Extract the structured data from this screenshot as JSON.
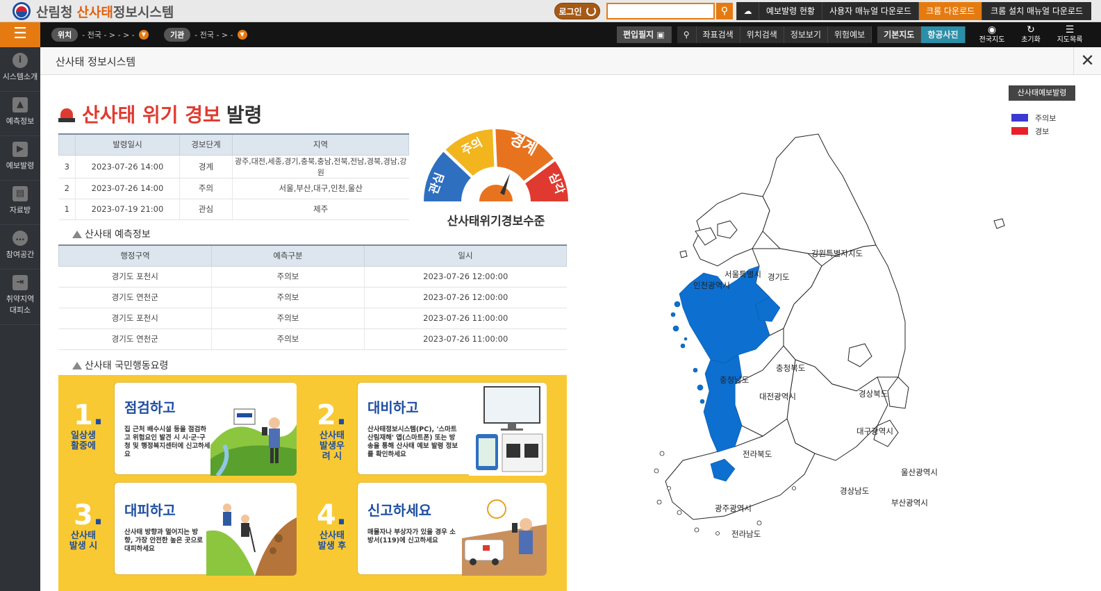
{
  "header": {
    "logo_main": "산림청",
    "logo_sub_accent": "산사태",
    "logo_sub_rest": "정보시스템",
    "login_label": "로그인",
    "search_placeholder": "",
    "links": [
      "예보발령 현황",
      "사용자 매뉴얼 다운로드",
      "크롬 다운로드",
      "크롬 설치 매뉴얼 다운로드"
    ]
  },
  "navbar": {
    "location_tag": "위치",
    "location_value": "- 전국 - > - > -",
    "agency_tag": "기관",
    "agency_value": "- 전국 - > -",
    "buttons": [
      "편입필지",
      "좌표검색",
      "위치검색",
      "정보보기",
      "위험예보",
      "기본지도",
      "항공사진"
    ],
    "icons": [
      {
        "label": "전국지도",
        "icon": "eye-icon"
      },
      {
        "label": "초기화",
        "icon": "refresh-icon"
      },
      {
        "label": "지도목록",
        "icon": "list-icon"
      }
    ]
  },
  "sidebar": {
    "items": [
      {
        "label": "시스템소개",
        "icon": "info-icon"
      },
      {
        "label": "예측정보",
        "icon": "siren-icon"
      },
      {
        "label": "예보발령",
        "icon": "speaker-icon"
      },
      {
        "label": "자료방",
        "icon": "book-icon"
      },
      {
        "label": "참여공간",
        "icon": "chat-icon"
      },
      {
        "label": "취약지역 대피소",
        "label_l1": "취약지역",
        "label_l2": "대피소",
        "icon": "exit-icon"
      }
    ]
  },
  "panel": {
    "title": "산사태 정보시스템",
    "alert_title_red": "산사태 위기 경보",
    "alert_title_dark": "발령",
    "warning_table": {
      "headers": [
        "",
        "발령일시",
        "경보단계",
        "지역"
      ],
      "rows": [
        [
          "3",
          "2023-07-26 14:00",
          "경계",
          "광주,대전,세종,경기,충북,충남,전북,전남,경북,경남,강원"
        ],
        [
          "2",
          "2023-07-26 14:00",
          "주의",
          "서울,부산,대구,인천,울산"
        ],
        [
          "1",
          "2023-07-19 21:00",
          "관심",
          "제주"
        ]
      ]
    },
    "gauge": {
      "label": "산사태위기경보수준",
      "levels": [
        "관심",
        "주의",
        "경계",
        "심각"
      ],
      "colors": [
        "#2f6fc0",
        "#f2b51e",
        "#e8731f",
        "#e03a30"
      ]
    },
    "prediction_section_title": "산사태 예측정보",
    "prediction_table": {
      "headers": [
        "행정구역",
        "예측구분",
        "일시"
      ],
      "rows": [
        [
          "경기도 포천시",
          "주의보",
          "2023-07-26 12:00:00"
        ],
        [
          "경기도 연천군",
          "주의보",
          "2023-07-26 12:00:00"
        ],
        [
          "경기도 포천시",
          "주의보",
          "2023-07-26 11:00:00"
        ],
        [
          "경기도 연천군",
          "주의보",
          "2023-07-26 11:00:00"
        ]
      ]
    },
    "action_section_title": "산사태 국민행동요령",
    "steps": [
      {
        "num": "1",
        "label": "일상생활중에",
        "title": "점검하고",
        "text": "집 근처 배수시설 등을 점검하고 위험요인 발견 시 시·군·구청 및 행정복지센터에 신고하세요"
      },
      {
        "num": "2",
        "label": "산사태발생우려 시",
        "title": "대비하고",
        "text": "산사태정보시스템(PC), '스마트산림재해' 앱(스마트폰) 또는 방송을 통해 산사태 예보 발령 정보를 확인하세요"
      },
      {
        "num": "3",
        "label": "산사태발생 시",
        "title": "대피하고",
        "text": "산사태 방향과 멀어지는 방향, 가장 안전한 높은 곳으로 대피하세요"
      },
      {
        "num": "4",
        "label": "산사태발생 후",
        "title": "신고하세요",
        "text": "매몰자나 부상자가 있을 경우 소방서(119)에 신고하세요"
      }
    ],
    "forecast_button": "산사태예보발령",
    "legend": [
      {
        "label": "주의보",
        "color": "#3a3ad0"
      },
      {
        "label": "경보",
        "color": "#e8202a"
      }
    ],
    "map_labels": [
      "강원특별자치도",
      "서울특별시",
      "경기도",
      "인천광역시",
      "충청북도",
      "충청남도",
      "대전광역시",
      "경상북도",
      "대구광역시",
      "전라북도",
      "울산광역시",
      "경상남도",
      "부산광역시",
      "광주광역시",
      "전라남도"
    ],
    "map_fill_color": "#0d6fd0"
  }
}
